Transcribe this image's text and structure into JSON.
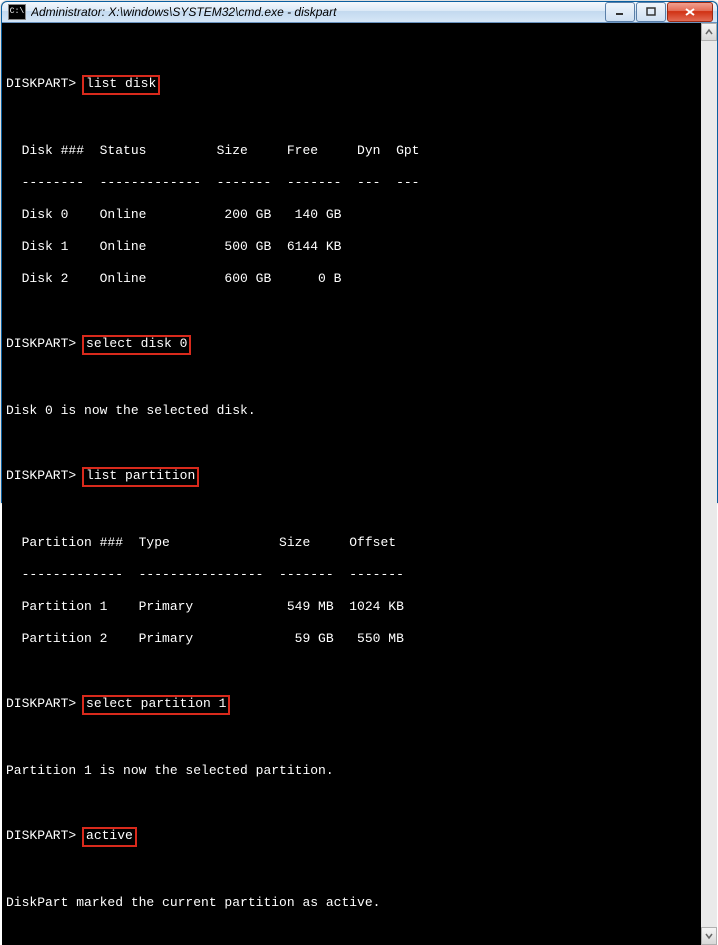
{
  "window": {
    "title": "Administrator: X:\\windows\\SYSTEM32\\cmd.exe - diskpart",
    "icon_label": "C:\\"
  },
  "prompt": "DISKPART>",
  "commands": {
    "c1": "list disk",
    "c2": "select disk 0",
    "c3": "list partition",
    "c4": "select partition 1",
    "c5": "active"
  },
  "disk_table": {
    "hdr": "  Disk ###  Status         Size     Free     Dyn  Gpt",
    "sep": "  --------  -------------  -------  -------  ---  ---",
    "rows": {
      "r0": "  Disk 0    Online          200 GB   140 GB",
      "r1": "  Disk 1    Online          500 GB  6144 KB",
      "r2": "  Disk 2    Online          600 GB      0 B"
    }
  },
  "msg_select_disk": "Disk 0 is now the selected disk.",
  "part_table": {
    "hdr": "  Partition ###  Type              Size     Offset",
    "sep": "  -------------  ----------------  -------  -------",
    "rows": {
      "r0": "  Partition 1    Primary            549 MB  1024 KB",
      "r1": "  Partition 2    Primary             59 GB   550 MB"
    }
  },
  "msg_select_part": "Partition 1 is now the selected partition.",
  "msg_active": "DiskPart marked the current partition as active.",
  "chart_data": [
    {
      "type": "table",
      "title": "list disk",
      "columns": [
        "Disk ###",
        "Status",
        "Size",
        "Free",
        "Dyn",
        "Gpt"
      ],
      "rows": [
        [
          "Disk 0",
          "Online",
          "200 GB",
          "140 GB",
          "",
          ""
        ],
        [
          "Disk 1",
          "Online",
          "500 GB",
          "6144 KB",
          "",
          ""
        ],
        [
          "Disk 2",
          "Online",
          "600 GB",
          "0 B",
          "",
          ""
        ]
      ]
    },
    {
      "type": "table",
      "title": "list partition",
      "columns": [
        "Partition ###",
        "Type",
        "Size",
        "Offset"
      ],
      "rows": [
        [
          "Partition 1",
          "Primary",
          "549 MB",
          "1024 KB"
        ],
        [
          "Partition 2",
          "Primary",
          "59 GB",
          "550 MB"
        ]
      ]
    }
  ]
}
